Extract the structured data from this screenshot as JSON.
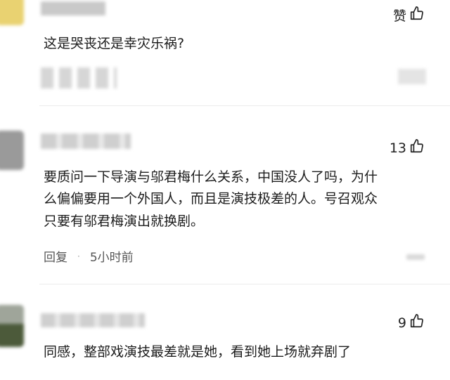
{
  "colors": {
    "accent_yellow": "#e9d271",
    "avatar_gray": "#9a9a9a",
    "avatar_green": "#4c5a3a",
    "text": "#1c1c1c",
    "meta": "#555555"
  },
  "comments": [
    {
      "like_label": "赞",
      "text": "这是哭丧还是幸灾乐祸?"
    },
    {
      "like_count": "13",
      "text_lines": [
        "要质问一下导演与邬君梅什么关系，中国没人了吗，为什",
        "么偏偏要用一个外国人，而且是演技极差的人。号召观众",
        "只要有邬君梅演出就换剧。"
      ],
      "reply_label": "回复",
      "separator": "·",
      "time": "5小时前"
    },
    {
      "like_count": "9",
      "text": "同感，整部戏演技最差就是她，看到她上场就弃剧了"
    }
  ],
  "icons": {
    "like": "thumbs-up-icon"
  }
}
